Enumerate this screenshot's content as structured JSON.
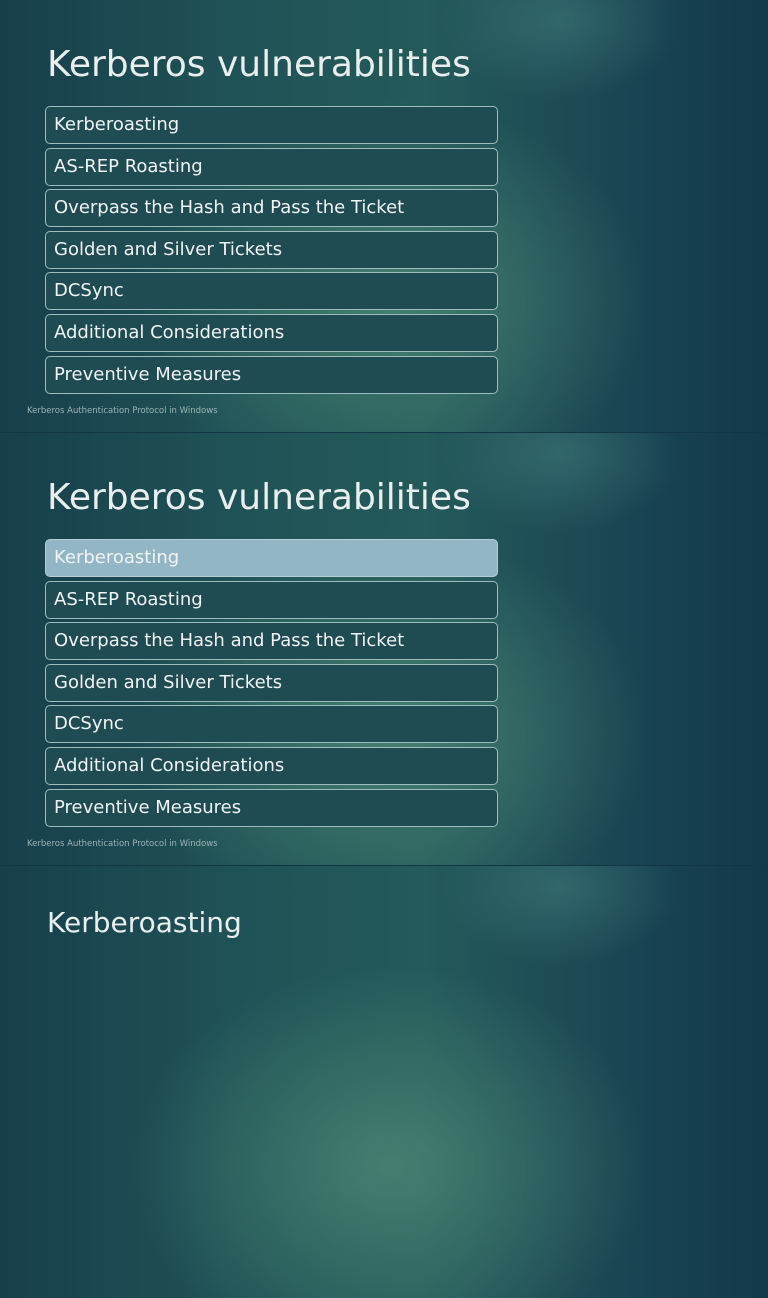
{
  "slides": [
    {
      "title": "Kerberos vulnerabilities",
      "items": [
        "Kerberoasting",
        "AS-REP Roasting",
        "Overpass the Hash and Pass the Ticket",
        "Golden and Silver Tickets",
        "DCSync",
        "Additional Considerations",
        "Preventive Measures"
      ],
      "footer": "Kerberos Authentication Protocol in Windows"
    },
    {
      "title": "Kerberos vulnerabilities",
      "items": [
        "Kerberoasting",
        "AS-REP Roasting",
        "Overpass the Hash and Pass the Ticket",
        "Golden and Silver Tickets",
        "DCSync",
        "Additional Considerations",
        "Preventive Measures"
      ],
      "active_item": "Kerberoasting",
      "footer": "Kerberos Authentication Protocol in Windows"
    },
    {
      "title": "Kerberoasting"
    }
  ]
}
